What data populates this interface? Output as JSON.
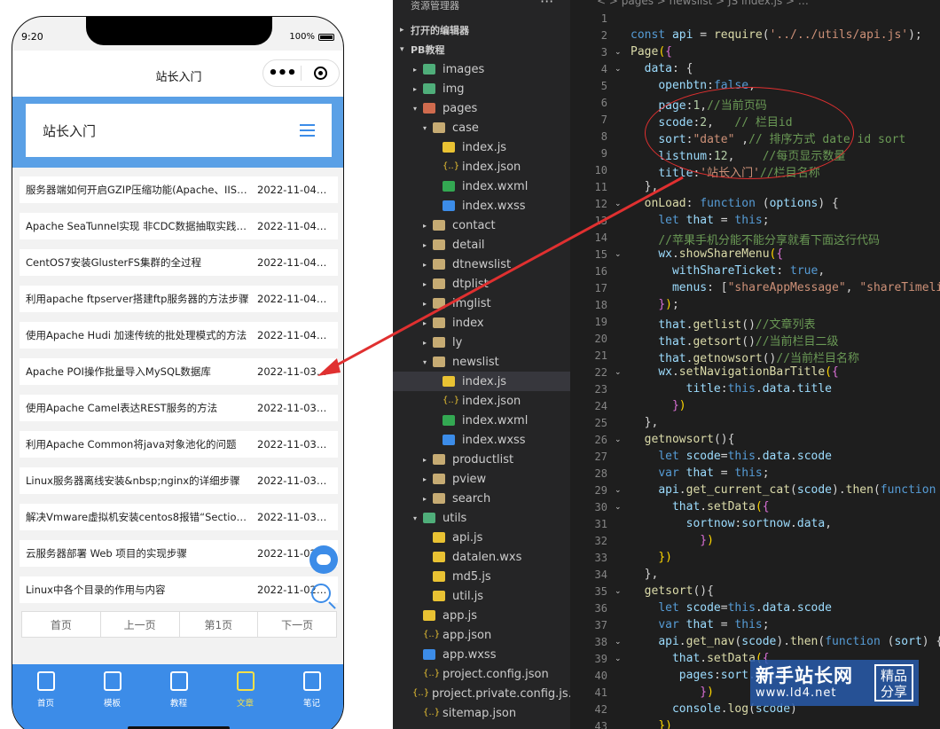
{
  "phone": {
    "status_time": "9:20",
    "battery": "100%",
    "nav_title": "站长入门",
    "header_title": "站长入门",
    "items": [
      {
        "title": "服务器端如何开启GZIP压缩功能(Apache、IIS…",
        "date": "2022-11-04…"
      },
      {
        "title": "Apache SeaTunnel实现 非CDC数据抽取实践…",
        "date": "2022-11-04…"
      },
      {
        "title": "CentOS7安装GlusterFS集群的全过程",
        "date": "2022-11-04…"
      },
      {
        "title": "利用apache ftpserver搭建ftp服务器的方法步骤",
        "date": "2022-11-04…"
      },
      {
        "title": "使用Apache Hudi 加速传统的批处理模式的方法",
        "date": "2022-11-04…"
      },
      {
        "title": "Apache POI操作批量导入MySQL数据库",
        "date": "2022-11-03…"
      },
      {
        "title": "使用Apache Camel表达REST服务的方法",
        "date": "2022-11-03…"
      },
      {
        "title": "利用Apache Common将java对象池化的问题",
        "date": "2022-11-03…"
      },
      {
        "title": "Linux服务器离线安装&nbsp;nginx的详细步骤",
        "date": "2022-11-03…"
      },
      {
        "title": "解决Vmware虚拟机安装centos8报错“Sectio…",
        "date": "2022-11-03…"
      },
      {
        "title": "云服务器部署 Web 项目的实现步骤",
        "date": "2022-11-02…"
      },
      {
        "title": "Linux中各个目录的作用与内容",
        "date": "2022-11-02…"
      }
    ],
    "pager": [
      "首页",
      "上一页",
      "第1页",
      "下一页"
    ],
    "tabs": [
      {
        "label": "首页",
        "icon": "home-icon"
      },
      {
        "label": "模板",
        "icon": "layers-icon"
      },
      {
        "label": "教程",
        "icon": "book-icon"
      },
      {
        "label": "文章",
        "icon": "document-icon"
      },
      {
        "label": "笔记",
        "icon": "note-icon"
      }
    ]
  },
  "explorer": {
    "title": "资源管理器",
    "section_open": "打开的编辑器",
    "section_project": "PB教程",
    "tree": [
      {
        "label": "images",
        "type": "folder-g",
        "arrow": "▸",
        "indent": 1
      },
      {
        "label": "img",
        "type": "folder-g",
        "arrow": "▸",
        "indent": 1
      },
      {
        "label": "pages",
        "type": "folder-r",
        "arrow": "▾",
        "indent": 1
      },
      {
        "label": "case",
        "type": "folder",
        "arrow": "▾",
        "indent": 2
      },
      {
        "label": "index.js",
        "type": "js",
        "arrow": "",
        "indent": 3
      },
      {
        "label": "index.json",
        "type": "json",
        "arrow": "",
        "indent": 3
      },
      {
        "label": "index.wxml",
        "type": "wxml",
        "arrow": "",
        "indent": 3
      },
      {
        "label": "index.wxss",
        "type": "wxss",
        "arrow": "",
        "indent": 3
      },
      {
        "label": "contact",
        "type": "folder",
        "arrow": "▸",
        "indent": 2
      },
      {
        "label": "detail",
        "type": "folder",
        "arrow": "▸",
        "indent": 2
      },
      {
        "label": "dtnewslist",
        "type": "folder",
        "arrow": "▸",
        "indent": 2
      },
      {
        "label": "dtplist",
        "type": "folder",
        "arrow": "▸",
        "indent": 2
      },
      {
        "label": "imglist",
        "type": "folder",
        "arrow": "▸",
        "indent": 2
      },
      {
        "label": "index",
        "type": "folder",
        "arrow": "▸",
        "indent": 2
      },
      {
        "label": "ly",
        "type": "folder",
        "arrow": "▸",
        "indent": 2
      },
      {
        "label": "newslist",
        "type": "folder",
        "arrow": "▾",
        "indent": 2
      },
      {
        "label": "index.js",
        "type": "js",
        "arrow": "",
        "indent": 3,
        "selected": true
      },
      {
        "label": "index.json",
        "type": "json",
        "arrow": "",
        "indent": 3
      },
      {
        "label": "index.wxml",
        "type": "wxml",
        "arrow": "",
        "indent": 3
      },
      {
        "label": "index.wxss",
        "type": "wxss",
        "arrow": "",
        "indent": 3
      },
      {
        "label": "productlist",
        "type": "folder",
        "arrow": "▸",
        "indent": 2
      },
      {
        "label": "pview",
        "type": "folder",
        "arrow": "▸",
        "indent": 2
      },
      {
        "label": "search",
        "type": "folder",
        "arrow": "▸",
        "indent": 2
      },
      {
        "label": "utils",
        "type": "folder-g",
        "arrow": "▾",
        "indent": 1
      },
      {
        "label": "api.js",
        "type": "js",
        "arrow": "",
        "indent": 2
      },
      {
        "label": "datalen.wxs",
        "type": "js",
        "arrow": "",
        "indent": 2
      },
      {
        "label": "md5.js",
        "type": "js",
        "arrow": "",
        "indent": 2
      },
      {
        "label": "util.js",
        "type": "js",
        "arrow": "",
        "indent": 2
      },
      {
        "label": "app.js",
        "type": "js",
        "arrow": "",
        "indent": 1
      },
      {
        "label": "app.json",
        "type": "json",
        "arrow": "",
        "indent": 1
      },
      {
        "label": "app.wxss",
        "type": "wxss",
        "arrow": "",
        "indent": 1
      },
      {
        "label": "project.config.json",
        "type": "json",
        "arrow": "",
        "indent": 1
      },
      {
        "label": "project.private.config.js…",
        "type": "json",
        "arrow": "",
        "indent": 1
      },
      {
        "label": "sitemap.json",
        "type": "json",
        "arrow": "",
        "indent": 1
      }
    ]
  },
  "editor": {
    "breadcrumb": "< >  pages > newslist > JS index.js > …",
    "lines": [
      {
        "n": "1",
        "html": ""
      },
      {
        "n": "2",
        "html": "<span class='kw2'>const</span> <span class='pr'>api</span> = <span class='fn'>require</span>(<span class='str'>'../../utils/api.js'</span>);"
      },
      {
        "n": "3",
        "fold": "v",
        "html": "<span class='fn'>Page</span><span class='br'>(</span><span class='br2'>{</span>"
      },
      {
        "n": "4",
        "fold": "v",
        "html": "  <span class='pr'>data</span>: {"
      },
      {
        "n": "5",
        "html": "    <span class='pr'>openbtn</span>:<span class='kw2'>false</span>,"
      },
      {
        "n": "6",
        "html": "    <span class='pr'>page</span>:<span class='num'>1</span>,<span class='cm'>//当前页码</span>"
      },
      {
        "n": "7",
        "html": "    <span class='pr'>scode</span>:<span class='num'>2</span>,   <span class='cm'>// 栏目id</span>"
      },
      {
        "n": "8",
        "html": "    <span class='pr'>sort</span>:<span class='str'>\"date\"</span> ,<span class='cm'>// 排序方式 date id sort</span>"
      },
      {
        "n": "9",
        "html": "    <span class='pr'>listnum</span>:<span class='num'>12</span>,    <span class='cm'>//每页显示数量</span>"
      },
      {
        "n": "10",
        "html": "    <span class='pr'>title</span>:<span class='str'>'站长入门'</span><span class='cm'>//栏目名称</span>"
      },
      {
        "n": "11",
        "html": "  },"
      },
      {
        "n": "12",
        "fold": "v",
        "html": "  <span class='fn'>onLoad</span>: <span class='kw2'>function</span> (<span class='pr'>options</span>) {"
      },
      {
        "n": "13",
        "html": "    <span class='kw2'>let</span> <span class='pr'>that</span> = <span class='kw2'>this</span>;"
      },
      {
        "n": "14",
        "html": "    <span class='cm'>//苹果手机分能不能分享就看下面这行代码</span>"
      },
      {
        "n": "15",
        "fold": "v",
        "html": "    <span class='pr'>wx</span>.<span class='fn'>showShareMenu</span><span class='br'>(</span><span class='br2'>{</span>"
      },
      {
        "n": "16",
        "html": "      <span class='pr'>withShareTicket</span>: <span class='kw2'>true</span>,"
      },
      {
        "n": "17",
        "html": "      <span class='pr'>menus</span>: [<span class='str'>\"shareAppMessage\"</span>, <span class='str'>\"shareTimeline\"</span>]"
      },
      {
        "n": "18",
        "html": "    <span class='br2'>}</span><span class='br'>)</span>;"
      },
      {
        "n": "19",
        "html": "    <span class='pr'>that</span>.<span class='fn'>getlist</span>()<span class='cm'>//文章列表</span>"
      },
      {
        "n": "20",
        "html": "    <span class='pr'>that</span>.<span class='fn'>getsort</span>()<span class='cm'>//当前栏目二级</span>"
      },
      {
        "n": "21",
        "html": "    <span class='pr'>that</span>.<span class='fn'>getnowsort</span>()<span class='cm'>//当前栏目名称</span>"
      },
      {
        "n": "22",
        "fold": "v",
        "html": "    <span class='pr'>wx</span>.<span class='fn'>setNavigationBarTitle</span><span class='br'>(</span><span class='br2'>{</span>"
      },
      {
        "n": "23",
        "html": "        <span class='pr'>title</span>:<span class='kw2'>this</span>.<span class='pr'>data</span>.<span class='pr'>title</span>"
      },
      {
        "n": "24",
        "html": "      <span class='br2'>}</span><span class='br'>)</span>"
      },
      {
        "n": "25",
        "html": "  },"
      },
      {
        "n": "26",
        "fold": "v",
        "html": "  <span class='fn'>getnowsort</span>(){"
      },
      {
        "n": "27",
        "html": "    <span class='kw2'>let</span> <span class='pr'>scode</span>=<span class='kw2'>this</span>.<span class='pr'>data</span>.<span class='pr'>scode</span>"
      },
      {
        "n": "28",
        "html": "    <span class='kw2'>var</span> <span class='pr'>that</span> = <span class='kw2'>this</span>;"
      },
      {
        "n": "29",
        "fold": "v",
        "html": "    <span class='pr'>api</span>.<span class='fn'>get_current_cat</span>(<span class='pr'>scode</span>).<span class='fn'>then</span>(<span class='kw2'>function</span> (sortnow) {"
      },
      {
        "n": "30",
        "fold": "v",
        "html": "      <span class='pr'>that</span>.<span class='fn'>setData</span><span class='br'>(</span><span class='br2'>{</span>"
      },
      {
        "n": "31",
        "html": "        <span class='pr'>sortnow</span>:<span class='pr'>sortnow</span>.<span class='pr'>data</span>,"
      },
      {
        "n": "32",
        "html": "          <span class='br2'>}</span><span class='br'>)</span>"
      },
      {
        "n": "33",
        "html": "    <span class='br'>})</span>"
      },
      {
        "n": "34",
        "html": "  },"
      },
      {
        "n": "35",
        "fold": "v",
        "html": "  <span class='fn'>getsort</span>(){"
      },
      {
        "n": "36",
        "html": "    <span class='kw2'>let</span> <span class='pr'>scode</span>=<span class='kw2'>this</span>.<span class='pr'>data</span>.<span class='pr'>scode</span>"
      },
      {
        "n": "37",
        "html": "    <span class='kw2'>var</span> <span class='pr'>that</span> = <span class='kw2'>this</span>;"
      },
      {
        "n": "38",
        "fold": "v",
        "html": "    <span class='pr'>api</span>.<span class='fn'>get_nav</span>(<span class='pr'>scode</span>).<span class='fn'>then</span>(<span class='kw2'>function</span> (<span class='pr'>sort</span>) {"
      },
      {
        "n": "39",
        "fold": "v",
        "html": "      <span class='pr'>that</span>.<span class='fn'>setData</span><span class='br'>(</span><span class='br2'>{</span>"
      },
      {
        "n": "40",
        "html": "       <span class='pr'>pages</span>:<span class='pr'>sort</span>.<span class='pr'>data</span>,"
      },
      {
        "n": "41",
        "html": "          <span class='br2'>}</span><span class='br'>)</span>"
      },
      {
        "n": "42",
        "html": "      <span class='pr'>console</span>.<span class='fn'>log</span>(<span class='pr'>scode</span>)"
      },
      {
        "n": "43",
        "html": "    <span class='br'>})</span>"
      }
    ]
  },
  "watermark": {
    "brand": "新手站长网",
    "url": "www.ld4.net",
    "badge": "精品分享"
  },
  "colors": {
    "accent": "#3c8ce8",
    "header_band": "#5aa0e6",
    "active_tab": "#f5e04a",
    "annotation": "#e03030"
  }
}
